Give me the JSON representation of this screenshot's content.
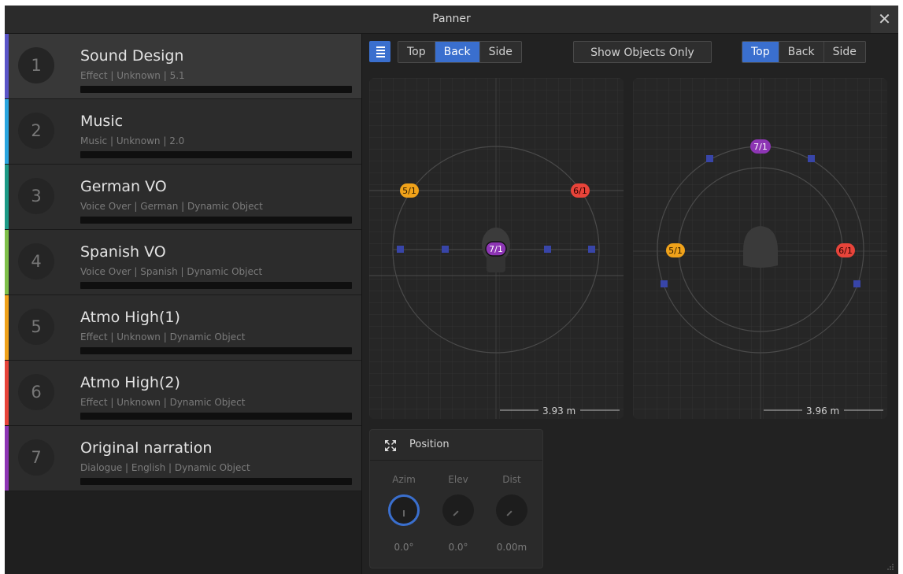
{
  "window": {
    "title": "Panner",
    "close_glyph": "✕"
  },
  "tracks": [
    {
      "num": "1",
      "name": "Sound Design",
      "meta": "Effect | Unknown | 5.1",
      "color": "#5a55c8",
      "selected": true
    },
    {
      "num": "2",
      "name": "Music",
      "meta": "Music | Unknown | 2.0",
      "color": "#2aa6e0",
      "selected": false
    },
    {
      "num": "3",
      "name": "German VO",
      "meta": "Voice Over | German | Dynamic Object",
      "color": "#1c9a86",
      "selected": false
    },
    {
      "num": "4",
      "name": "Spanish VO",
      "meta": "Voice Over | Spanish | Dynamic Object",
      "color": "#7fc04a",
      "selected": false
    },
    {
      "num": "5",
      "name": "Atmo High(1)",
      "meta": "Effect | Unknown | Dynamic Object",
      "color": "#f0a21a",
      "selected": false
    },
    {
      "num": "6",
      "name": "Atmo High(2)",
      "meta": "Effect | Unknown | Dynamic Object",
      "color": "#e8443a",
      "selected": false
    },
    {
      "num": "7",
      "name": "Original narration",
      "meta": "Dialogue | English | Dynamic Object",
      "color": "#8d35b4",
      "selected": false
    }
  ],
  "toolbar": {
    "list_icon": "list-icon",
    "view1_tabs": [
      "Top",
      "Back",
      "Side"
    ],
    "view1_active": "Back",
    "show_objects_label": "Show Objects Only",
    "view2_tabs": [
      "Top",
      "Back",
      "Side"
    ],
    "view2_active": "Top"
  },
  "views": {
    "back": {
      "scale_label": "3.93 m",
      "objects": [
        {
          "label": "5/1",
          "color": "#f0a21a"
        },
        {
          "label": "6/1",
          "color": "#e8443a"
        },
        {
          "label": "7/1",
          "color": "#8d35b4"
        }
      ]
    },
    "top": {
      "scale_label": "3.96 m",
      "objects": [
        {
          "label": "7/1",
          "color": "#8d35b4"
        },
        {
          "label": "5/1",
          "color": "#f0a21a"
        },
        {
          "label": "6/1",
          "color": "#e8443a"
        }
      ]
    },
    "speaker_color": "#3845a8"
  },
  "position_panel": {
    "title": "Position",
    "knobs": [
      {
        "label": "Azim",
        "value": "0.0°",
        "active": true
      },
      {
        "label": "Elev",
        "value": "0.0°",
        "active": false
      },
      {
        "label": "Dist",
        "value": "0.00m",
        "active": false
      }
    ]
  }
}
